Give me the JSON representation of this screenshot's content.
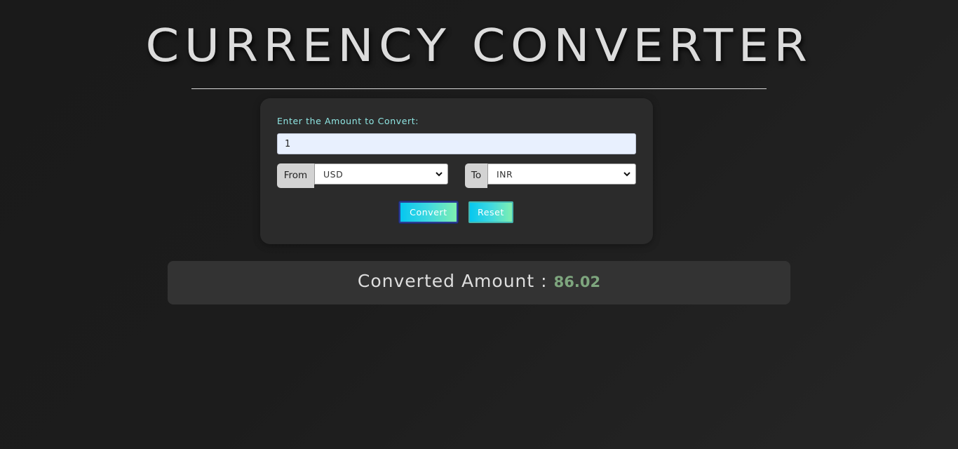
{
  "title": "CURRENCY CONVERTER",
  "form": {
    "amount_label": "Enter the Amount to Convert:",
    "amount_value": "1",
    "from_label": "From",
    "from_value": "USD",
    "to_label": "To",
    "to_value": "INR",
    "convert_label": "Convert",
    "reset_label": "Reset"
  },
  "result": {
    "label": "Converted Amount :",
    "value": "86.02"
  },
  "icons": {
    "dropdown": "chevron-down-icon"
  },
  "colors": {
    "accent_label": "#8fe6e3",
    "result_value": "#7ea67e",
    "button_gradient_start": "#06c7f0",
    "button_gradient_end": "#7fefb0"
  }
}
